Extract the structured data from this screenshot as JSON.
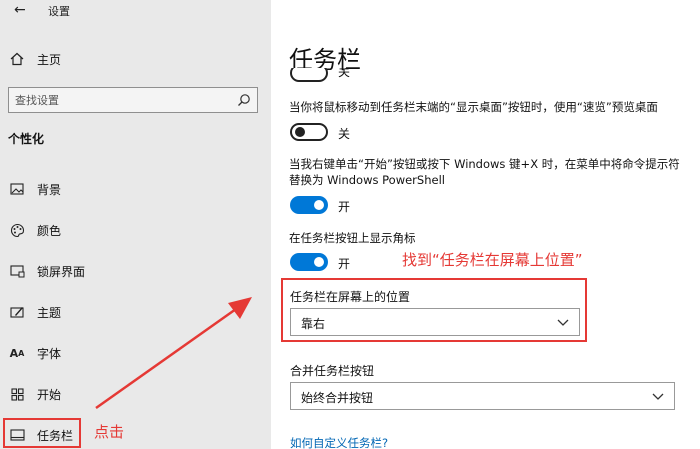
{
  "window": {
    "title": "设置"
  },
  "sidebar": {
    "home_label": "主页",
    "search_placeholder": "查找设置",
    "section_title": "个性化",
    "items": [
      {
        "label": "背景",
        "icon": "picture-icon"
      },
      {
        "label": "颜色",
        "icon": "palette-icon"
      },
      {
        "label": "锁屏界面",
        "icon": "lock-screen-icon"
      },
      {
        "label": "主题",
        "icon": "theme-icon"
      },
      {
        "label": "字体",
        "icon": "font-icon"
      },
      {
        "label": "开始",
        "icon": "start-icon"
      },
      {
        "label": "任务栏",
        "icon": "taskbar-icon",
        "active": true
      }
    ]
  },
  "main": {
    "title": "任务栏",
    "clipped_toggle_label": "关",
    "settings": [
      {
        "description": "当你将鼠标移动到任务栏末端的“显示桌面”按钮时，使用“速览”预览桌面",
        "state": "off",
        "state_label": "关"
      },
      {
        "description": "当我右键单击“开始”按钮或按下 Windows 键+X 时，在菜单中将命令提示符替换为 Windows PowerShell",
        "state": "on",
        "state_label": "开"
      },
      {
        "description": "在任务栏按钮上显示角标",
        "state": "on",
        "state_label": "开"
      }
    ],
    "position": {
      "label": "任务栏在屏幕上的位置",
      "value": "靠右"
    },
    "combine": {
      "label": "合并任务栏按钮",
      "value": "始终合并按钮"
    },
    "link": "如何自定义任务栏?"
  },
  "annotations": {
    "click_note": "点击",
    "find_note": "找到“任务栏在屏幕上位置”",
    "color": "#e53935"
  },
  "colors": {
    "accent": "#0078d7",
    "link": "#0066b4",
    "sidebar_bg": "#e9e9e9"
  }
}
